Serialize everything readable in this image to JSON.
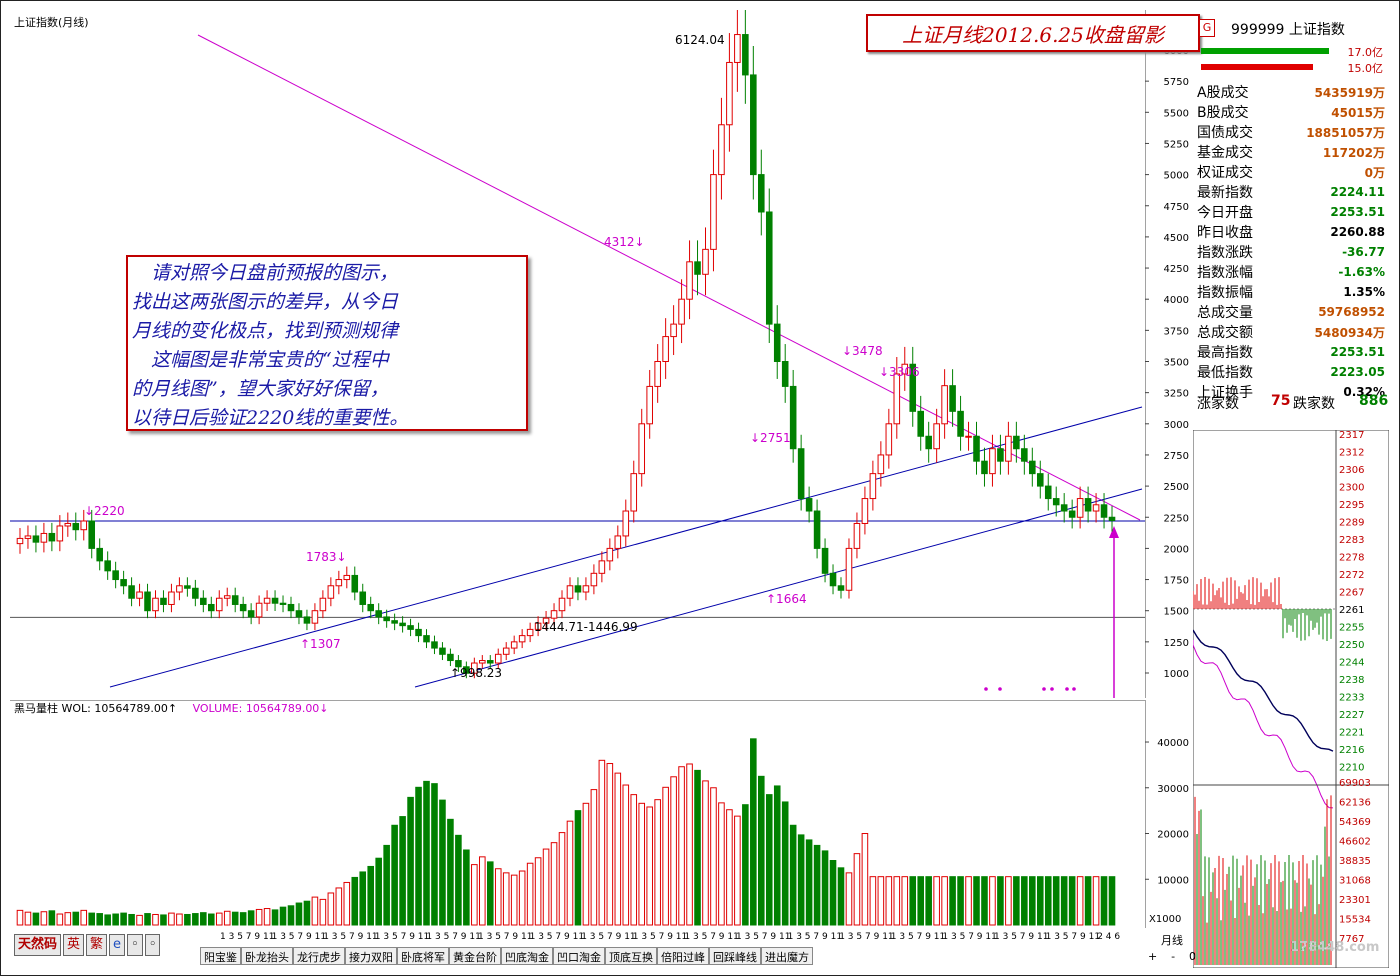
{
  "main_title": "上证指数(月线)",
  "banner_title": "上证月线2012.6.25收盘留影",
  "note_lines": [
    "　请对照今日盘前预报的图示，",
    "找出这两张图示的差异，从今日",
    "月线的变化极点，找到预测规律",
    "　这幅图是非常宝贵的“过程中",
    "的月线图”，望大家好好保留，",
    "以待日后验证2220线的重要性。"
  ],
  "vol_title": {
    "label": "黑马量柱 WOL: 10564789.00↑",
    "volume": "VOLUME: 10564789.00↓"
  },
  "colors": {
    "up": "#e00000",
    "down": "#008000",
    "trend_pink": "#cc00cc",
    "channel_blue": "#0000aa",
    "banner": "#c00000",
    "note_text": "#1a1aa6"
  },
  "quote": {
    "code": "999999",
    "name": "上证指数",
    "bar_up_pct": "17.0亿",
    "bar_down_pct": "15.0亿",
    "rows": [
      {
        "k": "A股成交",
        "v": "5435919万",
        "c": "#c05000"
      },
      {
        "k": "B股成交",
        "v": "45015万",
        "c": "#c05000"
      },
      {
        "k": "国债成交",
        "v": "18851057万",
        "c": "#c05000"
      },
      {
        "k": "基金成交",
        "v": "117202万",
        "c": "#c05000"
      },
      {
        "k": "权证成交",
        "v": "0万",
        "c": "#c05000"
      },
      {
        "k": "最新指数",
        "v": "2224.11",
        "c": "#008000"
      },
      {
        "k": "今日开盘",
        "v": "2253.51",
        "c": "#008000"
      },
      {
        "k": "昨日收盘",
        "v": "2260.88",
        "c": "#000000"
      },
      {
        "k": "指数涨跌",
        "v": "-36.77",
        "c": "#008000"
      },
      {
        "k": "指数涨幅",
        "v": "-1.63%",
        "c": "#008000"
      },
      {
        "k": "指数振幅",
        "v": "1.35%",
        "c": "#000000"
      },
      {
        "k": "总成交量",
        "v": "59768952",
        "c": "#c05000"
      },
      {
        "k": "总成交额",
        "v": "5480934万",
        "c": "#c05000"
      },
      {
        "k": "最高指数",
        "v": "2253.51",
        "c": "#008000"
      },
      {
        "k": "最低指数",
        "v": "2223.05",
        "c": "#008000"
      },
      {
        "k": "上证换手",
        "v": "0.32%",
        "c": "#000000"
      }
    ],
    "advancers_label": "涨家数",
    "advancers": "75",
    "decliners_label": "跌家数",
    "decliners": "886"
  },
  "intraday": {
    "price_ticks": [
      "2317",
      "2312",
      "2306",
      "2300",
      "2295",
      "2289",
      "2283",
      "2278",
      "2272",
      "2267",
      "2261",
      "2255",
      "2250",
      "2244",
      "2238",
      "2233",
      "2227",
      "2221",
      "2216",
      "2210"
    ],
    "vol_ticks": [
      "69903",
      "62136",
      "54369",
      "46602",
      "38835",
      "31068",
      "23301",
      "15534",
      "7767"
    ]
  },
  "chart_data": {
    "type": "candlestick",
    "title": "上证指数(月线)",
    "y_ticks_main": [
      "1000",
      "1250",
      "1500",
      "1750",
      "2000",
      "2250",
      "2500",
      "2750",
      "3000",
      "3250",
      "3500",
      "3750",
      "4000",
      "4250",
      "4500",
      "4750",
      "5000",
      "5250",
      "5500",
      "5750",
      "6000"
    ],
    "y_ticks_vol": [
      "10000",
      "20000",
      "30000",
      "40000"
    ],
    "vol_unit": "X1000",
    "ylim_main": [
      900,
      6200
    ],
    "ylim_vol": [
      0,
      47000
    ],
    "annotations": [
      {
        "text": "6124.04",
        "x": 1,
        "y": 6124.04
      },
      {
        "text": "4312↓",
        "x": 2,
        "y": 4312
      },
      {
        "text": "↓3478",
        "x": 3,
        "y": 3478
      },
      {
        "text": "↓3306",
        "x": 4,
        "y": 3306
      },
      {
        "text": "↓2751",
        "x": 5,
        "y": 2751
      },
      {
        "text": "↑1664",
        "x": 6,
        "y": 1664
      },
      {
        "text": "↓2220",
        "x": 7,
        "y": 2220
      },
      {
        "text": "1783↓",
        "x": 8,
        "y": 1783
      },
      {
        "text": "↑1307",
        "x": 9,
        "y": 1307
      },
      {
        "text": "↑998.23",
        "x": 10,
        "y": 998.23
      },
      {
        "text": "1444.71-1446.99",
        "x": 11,
        "y": 1446
      }
    ],
    "month_axis": [
      "1",
      "3",
      "5",
      "7",
      "9",
      "11",
      "1",
      "3",
      "5",
      "7",
      "9",
      "11",
      "1",
      "3",
      "5",
      "7",
      "9",
      "11",
      "1",
      "3",
      "5",
      "7",
      "9",
      "11",
      "1",
      "3",
      "5",
      "7",
      "9",
      "11",
      "1",
      "3",
      "5",
      "7",
      "9",
      "11",
      "1",
      "3",
      "5",
      "7",
      "9",
      "11",
      "1",
      "3",
      "5",
      "7",
      "9",
      "11",
      "1",
      "3",
      "5",
      "7",
      "9",
      "11",
      "1",
      "3",
      "5",
      "7",
      "9",
      "11",
      "1",
      "3",
      "5",
      "7",
      "9",
      "11",
      "1",
      "3",
      "5",
      "7",
      "9",
      "11",
      "1",
      "3",
      "5",
      "7",
      "9",
      "11",
      "1",
      "3",
      "5",
      "7",
      "9",
      "11",
      "1",
      "3",
      "5",
      "7",
      "9",
      "11",
      "1",
      "3",
      "5",
      "7",
      "9",
      "11",
      "1",
      "3",
      "5",
      "7",
      "9",
      "11",
      "2",
      "4",
      "6"
    ],
    "horizontal_lines": [
      2220,
      1446
    ],
    "closes": [
      2080,
      2100,
      2050,
      2120,
      2060,
      2180,
      2200,
      2150,
      2220,
      2000,
      1900,
      1820,
      1750,
      1700,
      1600,
      1650,
      1500,
      1600,
      1550,
      1650,
      1700,
      1680,
      1600,
      1550,
      1500,
      1600,
      1620,
      1550,
      1500,
      1450,
      1560,
      1600,
      1560,
      1550,
      1500,
      1450,
      1400,
      1500,
      1600,
      1700,
      1750,
      1783,
      1650,
      1550,
      1500,
      1450,
      1420,
      1400,
      1380,
      1350,
      1300,
      1250,
      1200,
      1150,
      1100,
      1050,
      998,
      1080,
      1100,
      1080,
      1150,
      1200,
      1250,
      1300,
      1350,
      1400,
      1440,
      1500,
      1600,
      1700,
      1650,
      1700,
      1800,
      1900,
      2000,
      2100,
      2300,
      2600,
      3000,
      3300,
      3500,
      3700,
      3800,
      4000,
      4300,
      4200,
      4400,
      5000,
      5400,
      5900,
      6124,
      5800,
      5000,
      4700,
      3800,
      3500,
      3300,
      2800,
      2400,
      2300,
      2000,
      1800,
      1700,
      1664,
      2000,
      2200,
      2400,
      2600,
      2750,
      3000,
      3400,
      3478,
      3100,
      2900,
      2800,
      3000,
      3306,
      3100,
      2900,
      2900,
      2700,
      2600,
      2800,
      2700,
      2900,
      2800,
      2700,
      2600,
      2500,
      2400,
      2350,
      2300,
      2250,
      2400,
      2300,
      2350,
      2250,
      2224
    ],
    "series": [
      {
        "name": "黑马量柱 WOL",
        "values": [
          3200,
          2800,
          2600,
          2900,
          3100,
          2400,
          2700,
          2800,
          3200,
          2600,
          2500,
          2200,
          2400,
          2600,
          2300,
          2100,
          2500,
          2300,
          2200,
          2600,
          2400,
          2300,
          2500,
          2700,
          2400,
          2600,
          3000,
          2800,
          2700,
          3100,
          3400,
          3600,
          3300,
          3900,
          4200,
          4800,
          5200,
          6100,
          5600,
          7000,
          8100,
          9300,
          10400,
          11600,
          12800,
          14600,
          17400,
          21800,
          23700,
          27900,
          30100,
          31400,
          30900,
          27300,
          23100,
          19600,
          16400,
          13200,
          14900,
          13800,
          12300,
          11400,
          10900,
          11800,
          13500,
          14700,
          16600,
          18000,
          20200,
          22700,
          25000,
          26600,
          29600,
          36000,
          35300,
          33200,
          30600,
          28500,
          26600,
          25800,
          27400,
          30100,
          32400,
          34600,
          35200,
          33800,
          31500,
          30000,
          26700,
          25200,
          23800,
          26300,
          40700,
          32500,
          28500,
          30400,
          26900,
          21800,
          19700,
          18600,
          17400,
          16200,
          14100,
          12500,
          11400,
          15600,
          20000,
          10565
        ]
      }
    ]
  },
  "tabs": [
    "阳宝鉴",
    "卧龙抬头",
    "龙行虎步",
    "接力双阳",
    "卧底将军",
    "黄金台阶",
    "凹底淘金",
    "凹口淘金",
    "顶底互换",
    "倍阳过峰",
    "回踩峰线",
    "进出魔方"
  ],
  "brand_buttons": [
    "天然码",
    "英",
    "繁",
    "e",
    "◦",
    "◦"
  ],
  "period_label": "月线",
  "page_buttons": [
    "+",
    "-",
    "0"
  ],
  "watermark": "178448.com"
}
